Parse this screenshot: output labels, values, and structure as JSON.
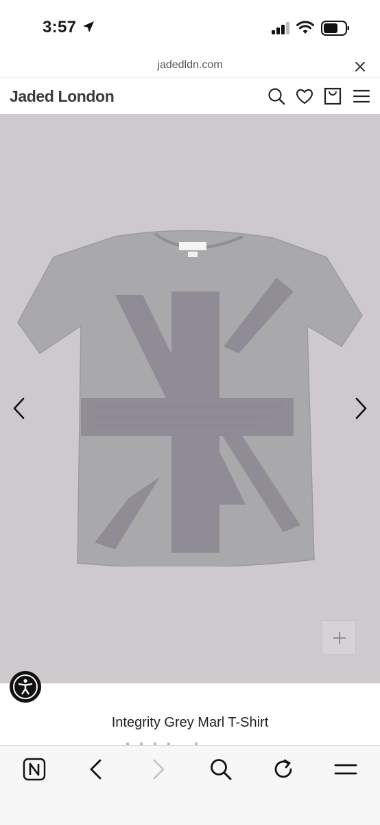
{
  "status_bar": {
    "time": "3:57",
    "icons": [
      "location-arrow-icon",
      "cellular-signal-icon",
      "wifi-icon",
      "battery-icon"
    ]
  },
  "browser": {
    "url": "jadedldn.com",
    "close_icon": "close-icon",
    "toolbar_icons": [
      "reader-n-icon",
      "back-icon",
      "forward-icon",
      "search-icon",
      "reload-icon",
      "menu-icon"
    ]
  },
  "header": {
    "logo": "Jaded London",
    "icons": [
      "search-icon",
      "heart-icon",
      "bag-icon",
      "hamburger-menu-icon"
    ]
  },
  "product": {
    "title": "Integrity Grey Marl T-Shirt",
    "image_alt": "Grey marl t-shirt with union jack print",
    "label_text": "Jaded London",
    "icons": [
      "previous-arrow-icon",
      "next-arrow-icon",
      "zoom-plus-icon",
      "accessibility-icon"
    ]
  },
  "colors": {
    "image_bg": "#cdc9cd",
    "shirt": "#a8a8ab",
    "print": "#8a8590",
    "accent": "#111111"
  }
}
